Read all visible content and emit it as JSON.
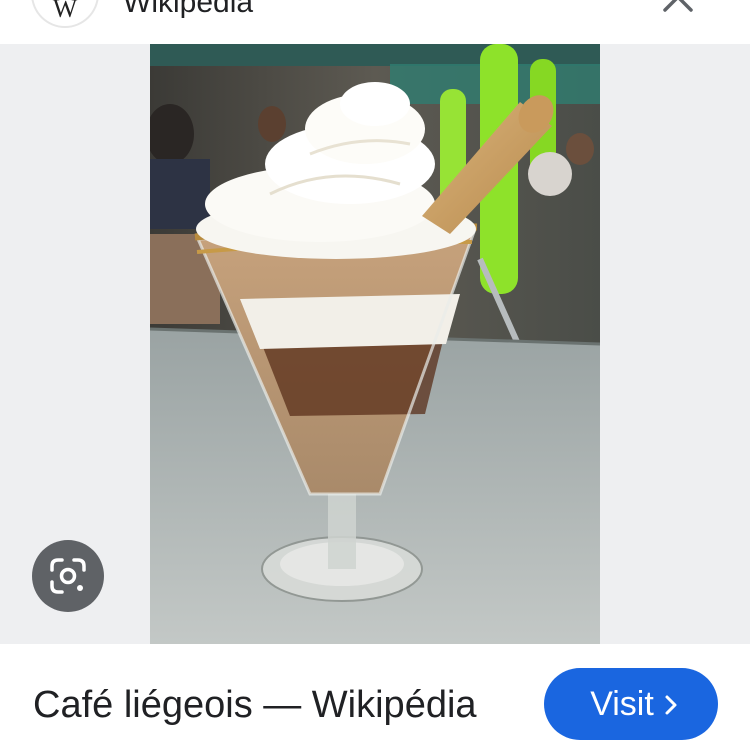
{
  "header": {
    "site_logo_letter": "W",
    "site_name": "Wikipédia",
    "more_icon": "more-vert-icon",
    "close_icon": "close-icon"
  },
  "image": {
    "subject": "Café liégeois dessert in a glass",
    "lens_icon": "google-lens-icon"
  },
  "footer": {
    "title": "Café liégeois — Wikipédia",
    "visit_label": "Visit",
    "visit_icon": "chevron-right-icon"
  },
  "colors": {
    "accent": "#1a66e0",
    "viewer_background": "#eeeff1",
    "lens_button": "#5f6266"
  }
}
